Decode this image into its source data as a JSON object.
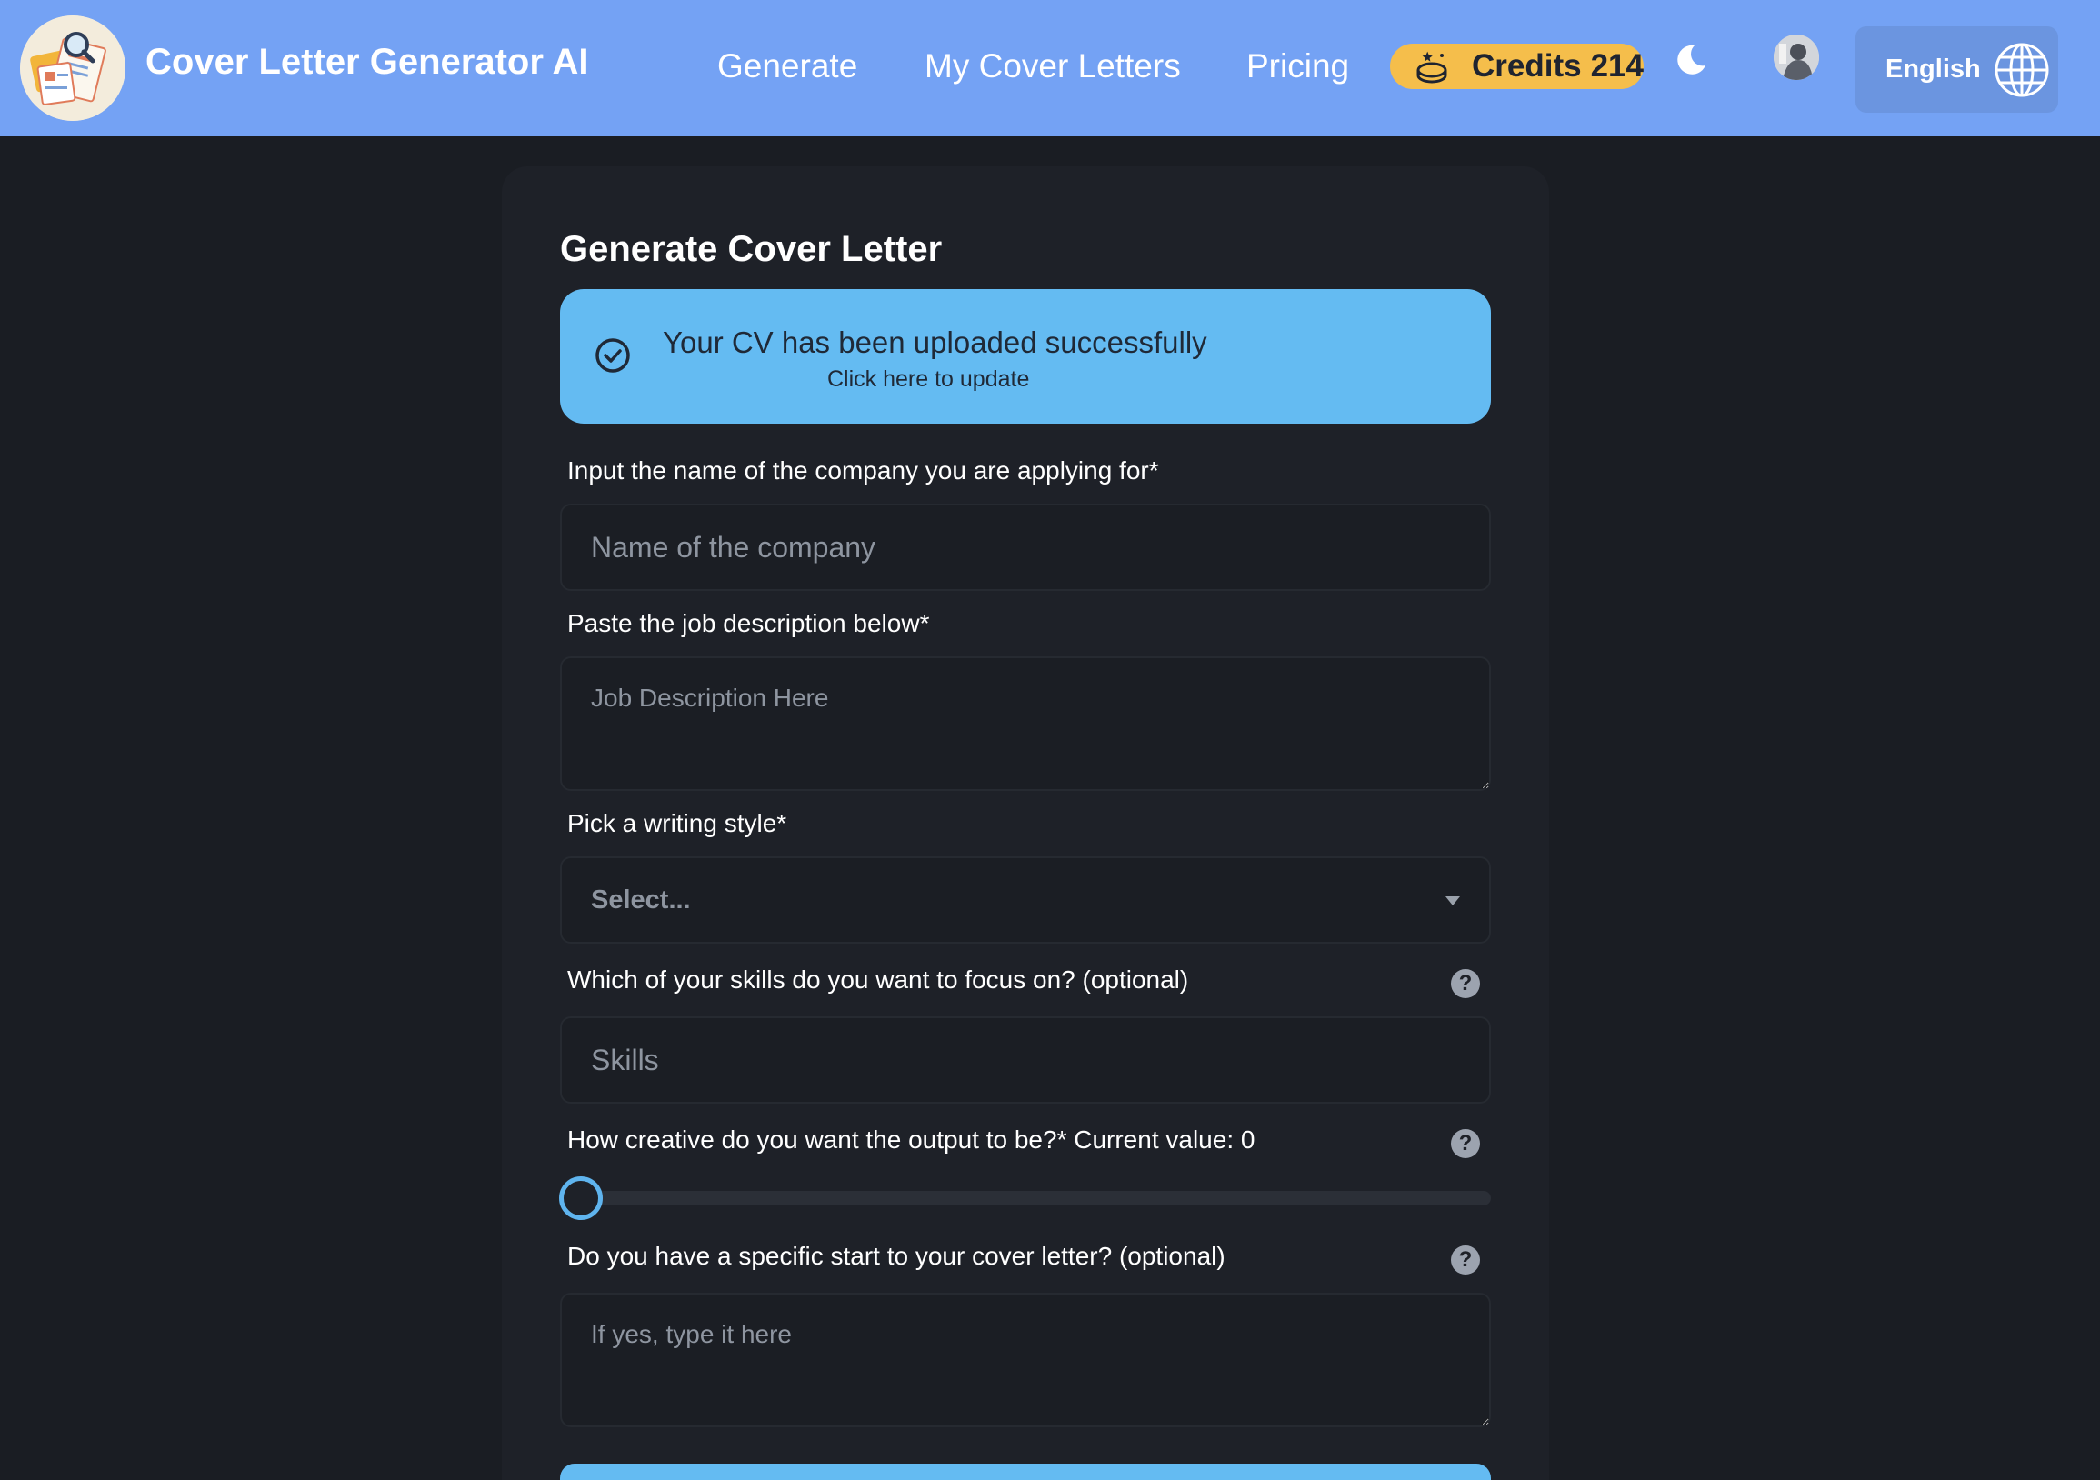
{
  "header": {
    "brand": "Cover Letter Generator AI",
    "nav": [
      {
        "label": "Generate"
      },
      {
        "label": "My Cover Letters"
      },
      {
        "label": "Pricing"
      }
    ],
    "credits": {
      "label": "Credits",
      "value": "214",
      "icon": "coin-icon",
      "color": "#f5be4b"
    },
    "theme_toggle_icon": "moon-icon",
    "language": {
      "label": "English",
      "icon": "globe-icon"
    },
    "color": "#74a2f4"
  },
  "form": {
    "title": "Generate Cover Letter",
    "alert": {
      "title": "Your CV has been uploaded successfully",
      "subtitle": "Click here to update",
      "icon": "check-circle-icon",
      "color": "#64bbf2"
    },
    "company": {
      "label": "Input the name of the company you are applying for*",
      "placeholder": "Name of the company",
      "value": ""
    },
    "job_description": {
      "label": "Paste the job description below*",
      "placeholder": "Job Description Here",
      "value": ""
    },
    "writing_style": {
      "label": "Pick a writing style*",
      "selected": "Select..."
    },
    "skills": {
      "label": "Which of your skills do you want to focus on? (optional)",
      "placeholder": "Skills",
      "value": ""
    },
    "creativity": {
      "label": "How creative do you want the output to be?* Current value: 0",
      "value": 0
    },
    "start": {
      "label": "Do you have a specific start to your cover letter? (optional)",
      "placeholder": "If yes, type it here",
      "value": ""
    },
    "help_glyph": "?"
  }
}
